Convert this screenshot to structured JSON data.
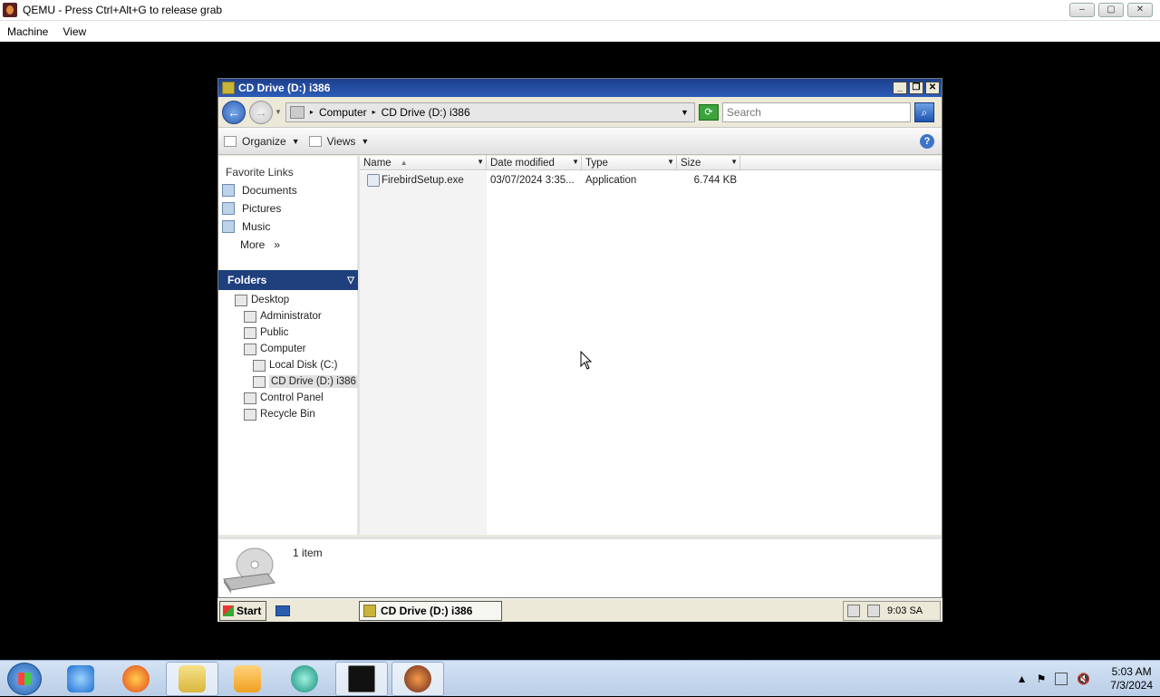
{
  "qemu": {
    "title": "QEMU - Press Ctrl+Alt+G to release grab",
    "menu": [
      "Machine",
      "View"
    ]
  },
  "explorer": {
    "title": "CD Drive (D:) i386",
    "address": {
      "crumbs": [
        "Computer",
        "CD Drive (D:) i386"
      ]
    },
    "search_placeholder": "Search",
    "toolbar": {
      "organize": "Organize",
      "views": "Views"
    },
    "favorites": {
      "title": "Favorite Links",
      "items": [
        "Documents",
        "Pictures",
        "Music",
        "More"
      ]
    },
    "folders": {
      "title": "Folders",
      "tree": [
        {
          "label": "Desktop",
          "level": 0,
          "icon": "desktop-icon"
        },
        {
          "label": "Administrator",
          "level": 1,
          "icon": "user-folder-icon"
        },
        {
          "label": "Public",
          "level": 1,
          "icon": "folder-icon"
        },
        {
          "label": "Computer",
          "level": 1,
          "icon": "computer-icon"
        },
        {
          "label": "Local Disk (C:)",
          "level": 2,
          "icon": "hard-drive-icon"
        },
        {
          "label": "CD Drive (D:) i386",
          "level": 2,
          "icon": "cd-drive-icon",
          "selected": true
        },
        {
          "label": "Control Panel",
          "level": 1,
          "icon": "control-panel-icon"
        },
        {
          "label": "Recycle Bin",
          "level": 1,
          "icon": "recycle-bin-icon"
        }
      ]
    },
    "columns": [
      "Name",
      "Date modified",
      "Type",
      "Size"
    ],
    "files": [
      {
        "name": "FirebirdSetup.exe",
        "date": "03/07/2024 3:35...",
        "type": "Application",
        "size": "6.744 KB"
      }
    ],
    "details": {
      "count": "1 item"
    }
  },
  "guest_taskbar": {
    "start": "Start",
    "window_button": "CD Drive (D:) i386",
    "clock": "9:03 SA"
  },
  "host_taskbar": {
    "apps": [
      "internet-explorer-icon",
      "firefox-icon",
      "file-explorer-icon",
      "media-player-icon",
      "browser-app-icon",
      "command-prompt-icon",
      "qemu-icon"
    ],
    "time": "5:03 AM",
    "date": "7/3/2024"
  },
  "colors": {
    "title_bar": "#1f3f7d",
    "folders_header": "#1f3f7d",
    "host_taskbar": "#c6d8ee"
  }
}
